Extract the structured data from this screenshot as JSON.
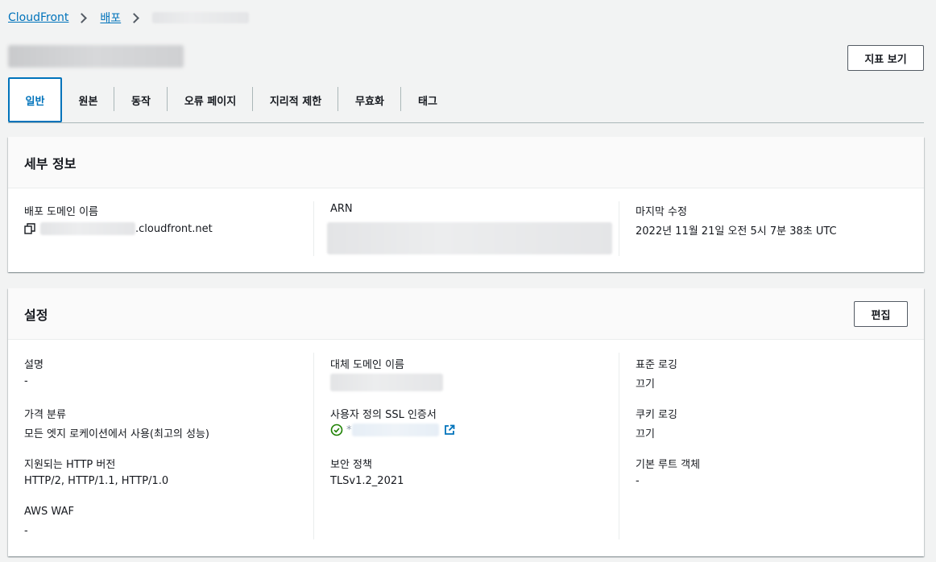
{
  "breadcrumb": {
    "root": "CloudFront",
    "section": "배포"
  },
  "header": {
    "metrics_button": "지표 보기"
  },
  "tabs": [
    "일반",
    "원본",
    "동작",
    "오류 페이지",
    "지리적 제한",
    "무효화",
    "태그"
  ],
  "details": {
    "title": "세부 정보",
    "domain_label": "배포 도메인 이름",
    "domain_suffix": ".cloudfront.net",
    "arn_label": "ARN",
    "modified_label": "마지막 수정",
    "modified_value": "2022년 11월 21일 오전 5시 7분 38초 UTC"
  },
  "settings": {
    "title": "설정",
    "edit_button": "편집",
    "description_label": "설명",
    "description_value": "-",
    "price_label": "가격 분류",
    "price_value": "모든 엣지 로케이션에서 사용(최고의 성능)",
    "http_label": "지원되는 HTTP 버전",
    "http_value": "HTTP/2, HTTP/1.1, HTTP/1.0",
    "waf_label": "AWS WAF",
    "waf_value": "-",
    "alt_domain_label": "대체 도메인 이름",
    "ssl_label": "사용자 정의 SSL 인증서",
    "ssl_prefix": "*",
    "policy_label": "보안 정책",
    "policy_value": "TLSv1.2_2021",
    "std_logging_label": "표준 로깅",
    "std_logging_value": "끄기",
    "cookie_logging_label": "쿠키 로깅",
    "cookie_logging_value": "끄기",
    "root_object_label": "기본 루트 객체",
    "root_object_value": "-"
  },
  "colors": {
    "link": "#0073bb",
    "success": "#1d8102",
    "border": "#545b64"
  }
}
